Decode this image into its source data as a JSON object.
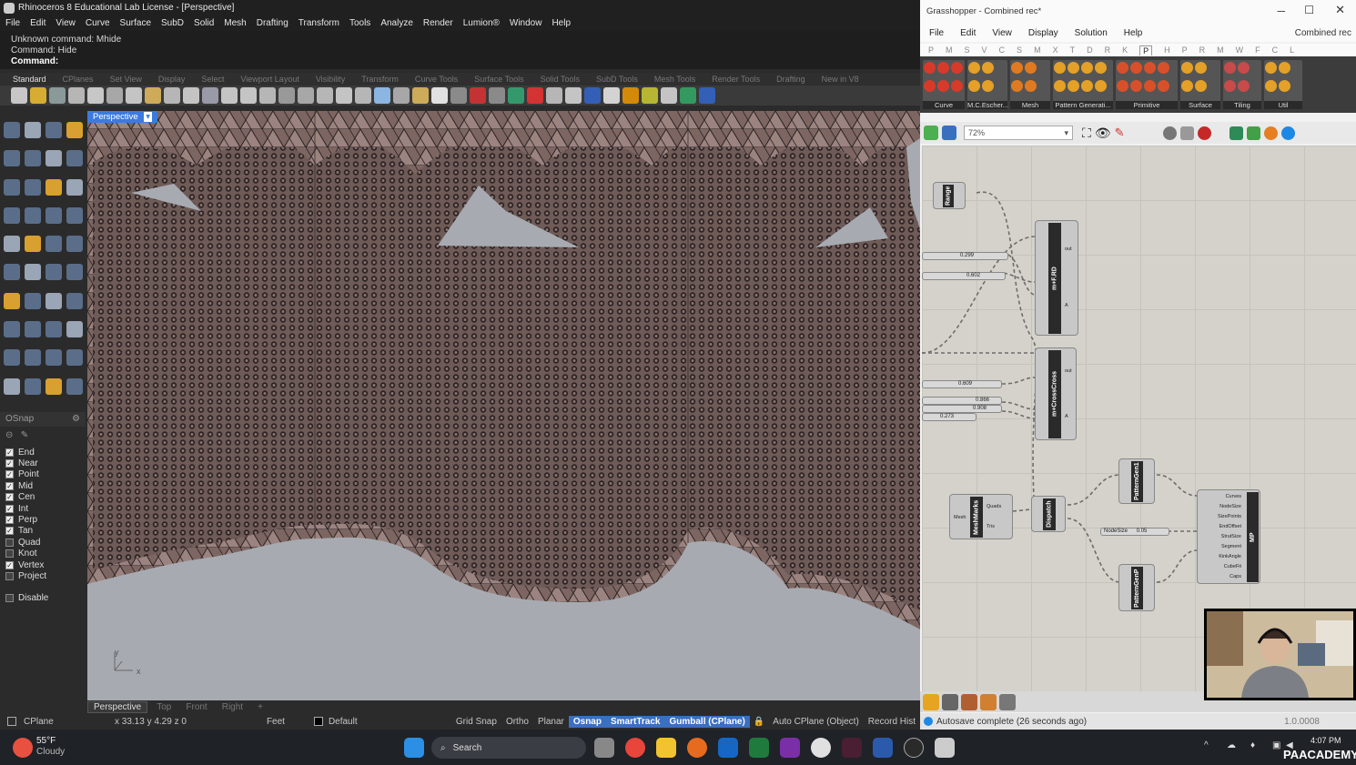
{
  "rhino": {
    "title": "Rhinoceros 8 Educational Lab License - [Perspective]",
    "menu": [
      "File",
      "Edit",
      "View",
      "Curve",
      "Surface",
      "SubD",
      "Solid",
      "Mesh",
      "Drafting",
      "Transform",
      "Tools",
      "Analyze",
      "Render",
      "Lumion®",
      "Window",
      "Help"
    ],
    "command_history": [
      "Unknown command: Mhide",
      "Command: Hide"
    ],
    "command_prompt": "Command:",
    "toolbar_tabs": [
      "Standard",
      "CPlanes",
      "Set View",
      "Display",
      "Select",
      "Viewport Layout",
      "Visibility",
      "Transform",
      "Curve Tools",
      "Surface Tools",
      "Solid Tools",
      "SubD Tools",
      "Mesh Tools",
      "Render Tools",
      "Drafting",
      "New in V8"
    ],
    "viewport_label": "Perspective",
    "viewport_tabs": [
      "Perspective",
      "Top",
      "Front",
      "Right"
    ],
    "add_tab": "+",
    "osnap": {
      "title": "OSnap",
      "items": [
        {
          "label": "End",
          "checked": true
        },
        {
          "label": "Near",
          "checked": true
        },
        {
          "label": "Point",
          "checked": true
        },
        {
          "label": "Mid",
          "checked": true
        },
        {
          "label": "Cen",
          "checked": true
        },
        {
          "label": "Int",
          "checked": true
        },
        {
          "label": "Perp",
          "checked": true
        },
        {
          "label": "Tan",
          "checked": true
        },
        {
          "label": "Quad",
          "checked": false
        },
        {
          "label": "Knot",
          "checked": false
        },
        {
          "label": "Vertex",
          "checked": true
        },
        {
          "label": "Project",
          "checked": false
        }
      ],
      "disable_label": "Disable"
    },
    "axis_y": "y",
    "axis_x": "x",
    "status": {
      "cplane": "CPlane",
      "coords": "x 33.13  y 4.29  z 0",
      "units": "Feet",
      "layer": "Default",
      "grid_snap": "Grid Snap",
      "ortho": "Ortho",
      "planar": "Planar",
      "osnap": "Osnap",
      "smarttrack": "SmartTrack",
      "gumball": "Gumball (CPlane)",
      "auto_cplane": "Auto CPlane (Object)",
      "record_history": "Record Hist"
    }
  },
  "grasshopper": {
    "title": "Grasshopper - Combined rec*",
    "menu": [
      "File",
      "Edit",
      "View",
      "Display",
      "Solution",
      "Help"
    ],
    "doc_name": "Combined rec",
    "tabs": [
      "P",
      "M",
      "S",
      "V",
      "C",
      "S",
      "M",
      "X",
      "T",
      "D",
      "R",
      "K",
      "P",
      "H",
      "P",
      "R",
      "M",
      "W",
      "F",
      "C",
      "L"
    ],
    "ribbon_groups": [
      "Curve",
      "M.C.Escher...",
      "Mesh",
      "Pattern Generati...",
      "Primitive",
      "Surface",
      "Tiling",
      "Util"
    ],
    "zoom": "72%",
    "components": {
      "range": "Range",
      "mfrd": "m+F.RD",
      "mcrosscross": "m+CrossCross",
      "meshmarks": "MeshMarks",
      "dispatch": "Dispatch",
      "patterngen1": "PatternGen1",
      "patterngen2": "PatternGenP",
      "mp": "MP",
      "mesh_in": "Mesh",
      "quads": "Quads",
      "tris": "Tris",
      "out": "out",
      "a": "A"
    },
    "sliders": {
      "s1": "0.299",
      "s2": "0.602",
      "s3": "0.609",
      "s4": "0.866",
      "s5": "0.908",
      "s6": "0.273",
      "nodesize_label": "NodeSize",
      "nodesize_val": "0.05"
    },
    "mp_inputs": [
      "Curves",
      "NodeSize",
      "SizePoints",
      "EndOffset",
      "StrutSize",
      "Segment",
      "KinkAngle",
      "CubeFit",
      "Caps"
    ],
    "status": "Autosave complete (26 seconds ago)",
    "version": "1.0.0008"
  },
  "taskbar": {
    "weather_temp": "55°F",
    "weather_desc": "Cloudy",
    "search": "Search",
    "time": "4:07 PM",
    "watermark": "PAACADEMY"
  }
}
